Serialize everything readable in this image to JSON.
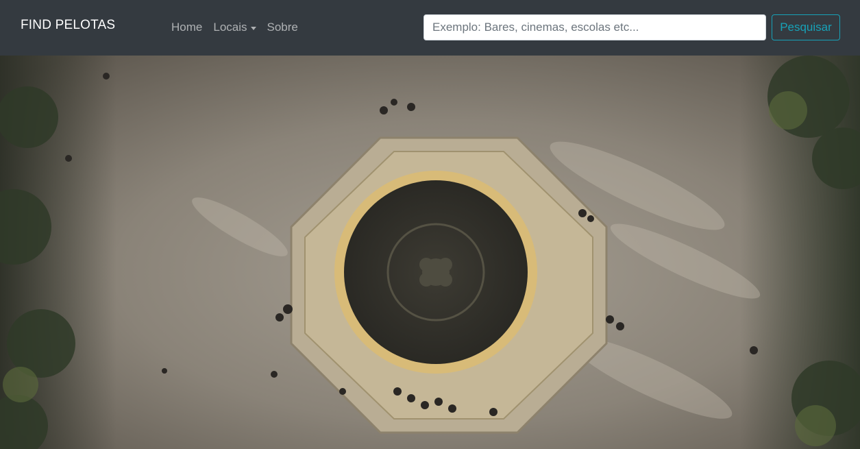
{
  "navbar": {
    "brand": "FIND PELOTAS",
    "links": [
      {
        "label": "Home"
      },
      {
        "label": "Locais",
        "dropdown": true
      },
      {
        "label": "Sobre"
      }
    ],
    "search": {
      "placeholder": "Exemplo: Bares, cinemas, escolas etc...",
      "value": "",
      "button_label": "Pesquisar"
    }
  },
  "colors": {
    "navbar_bg": "#343a40",
    "search_button_accent": "#17a2b8"
  },
  "icons": [
    "caret-down-icon"
  ]
}
